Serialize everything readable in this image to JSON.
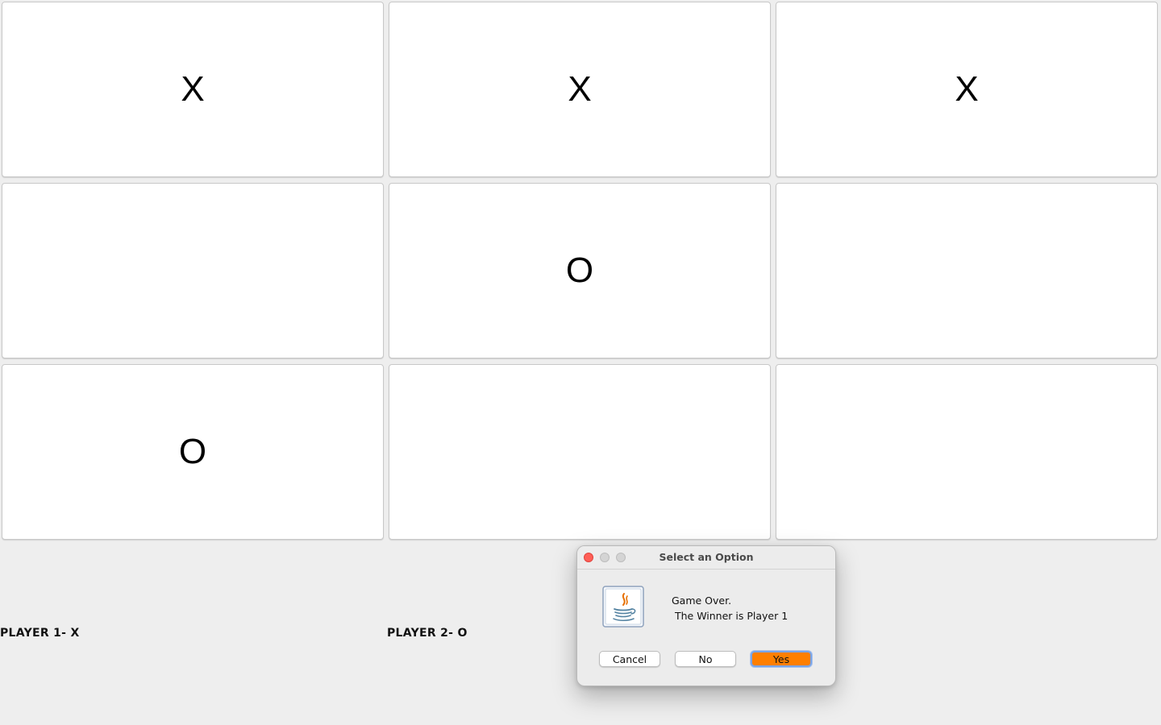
{
  "board": {
    "cells": [
      "X",
      "X",
      "X",
      "",
      "O",
      "",
      "O",
      "",
      ""
    ]
  },
  "players": {
    "player1": "PLAYER 1- X",
    "player2": "PLAYER 2- O"
  },
  "dialog": {
    "title": "Select an Option",
    "icon": "java-icon",
    "message_line1": "Game Over.",
    "message_line2": " The Winner is Player 1",
    "buttons": {
      "cancel": "Cancel",
      "no": "No",
      "yes": "Yes"
    },
    "default_button_color": "#ff7f00"
  }
}
